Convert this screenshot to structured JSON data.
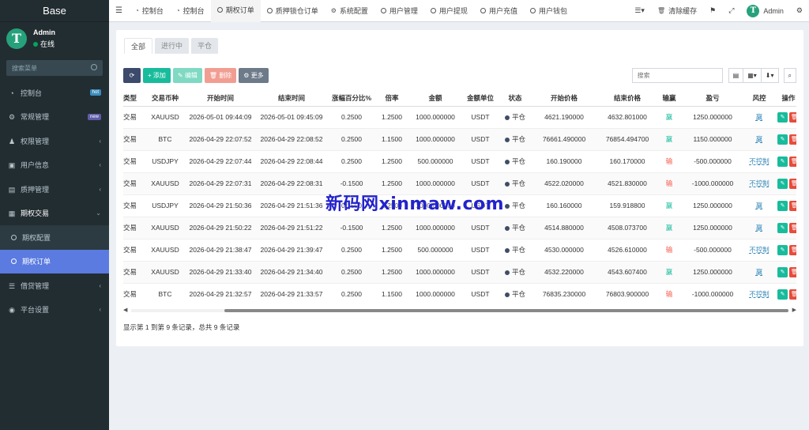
{
  "sidebar": {
    "brand": "Base",
    "user": {
      "name": "Admin",
      "status": "在线"
    },
    "search_placeholder": "搜索菜单",
    "items": [
      {
        "label": "控制台",
        "badge": "hot",
        "icon": "dashboard-icon"
      },
      {
        "label": "常规管理",
        "badge": "new",
        "icon": "cogs-icon"
      },
      {
        "label": "权限管理",
        "icon": "group-icon"
      },
      {
        "label": "用户信息",
        "icon": "user-card-icon"
      },
      {
        "label": "质押管理",
        "icon": "chart-icon"
      },
      {
        "label": "期权交易",
        "icon": "file-icon"
      }
    ],
    "sub_items": [
      {
        "label": "期权配置"
      },
      {
        "label": "期权订单"
      }
    ],
    "items_after": [
      {
        "label": "借贷管理",
        "icon": "list-icon"
      },
      {
        "label": "平台设置",
        "icon": "gear-icon"
      }
    ]
  },
  "topbar": {
    "tabs": [
      {
        "label": "控制台",
        "icon": "dashboard-icon"
      },
      {
        "label": "控制台",
        "icon": "dashboard-icon"
      },
      {
        "label": "期权订单",
        "icon": "circle-icon"
      },
      {
        "label": "质押锁仓订单",
        "icon": "circle-icon"
      },
      {
        "label": "系统配置",
        "icon": "gear-icon"
      },
      {
        "label": "用户管理",
        "icon": "circle-icon"
      },
      {
        "label": "用户提现",
        "icon": "circle-icon"
      },
      {
        "label": "用户充值",
        "icon": "circle-icon"
      },
      {
        "label": "用户钱包",
        "icon": "circle-icon"
      }
    ],
    "clear_cache": "清除缓存",
    "admin": "Admin"
  },
  "content": {
    "tabs": [
      "全部",
      "进行中",
      "平仓"
    ],
    "buttons": {
      "add": "添加",
      "edit": "编辑",
      "delete": "删除",
      "more": "更多"
    },
    "search_placeholder": "搜索",
    "columns": [
      "类型",
      "交易币种",
      "开始时间",
      "结束时间",
      "涨幅百分比%",
      "倍率",
      "金额",
      "金额单位",
      "状态",
      "开始价格",
      "结束价格",
      "输赢",
      "盈亏",
      "风控",
      "操作"
    ],
    "rows": [
      [
        "交易",
        "XAUUSD",
        "2026-05-01 09:44:09",
        "2026-05-01 09:45:09",
        "0.2500",
        "1.2500",
        "1000.000000",
        "USDT",
        "平仓",
        "4621.190000",
        "4632.801000",
        "赢",
        "1250.000000",
        "赢"
      ],
      [
        "交易",
        "BTC",
        "2026-04-29 22:07:52",
        "2026-04-29 22:08:52",
        "0.2500",
        "1.1500",
        "1000.000000",
        "USDT",
        "平仓",
        "76661.490000",
        "76854.494700",
        "赢",
        "1150.000000",
        "赢"
      ],
      [
        "交易",
        "USDJPY",
        "2026-04-29 22:07:44",
        "2026-04-29 22:08:44",
        "0.2500",
        "1.2500",
        "500.000000",
        "USDT",
        "平仓",
        "160.190000",
        "160.170000",
        "输",
        "-500.000000",
        "不控制"
      ],
      [
        "交易",
        "XAUUSD",
        "2026-04-29 22:07:31",
        "2026-04-29 22:08:31",
        "-0.1500",
        "1.2500",
        "1000.000000",
        "USDT",
        "平仓",
        "4522.020000",
        "4521.830000",
        "输",
        "-1000.000000",
        "不控制"
      ],
      [
        "交易",
        "USDJPY",
        "2026-04-29 21:50:36",
        "2026-04-29 21:51:36",
        "0.2500",
        "1.2500",
        "1000.000000",
        "USDT",
        "平仓",
        "160.160000",
        "159.918800",
        "赢",
        "1250.000000",
        "赢"
      ],
      [
        "交易",
        "XAUUSD",
        "2026-04-29 21:50:22",
        "2026-04-29 21:51:22",
        "-0.1500",
        "1.2500",
        "1000.000000",
        "USDT",
        "平仓",
        "4514.880000",
        "4508.073700",
        "赢",
        "1250.000000",
        "赢"
      ],
      [
        "交易",
        "XAUUSD",
        "2026-04-29 21:38:47",
        "2026-04-29 21:39:47",
        "0.2500",
        "1.2500",
        "500.000000",
        "USDT",
        "平仓",
        "4530.000000",
        "4526.610000",
        "输",
        "-500.000000",
        "不控制"
      ],
      [
        "交易",
        "XAUUSD",
        "2026-04-29 21:33:40",
        "2026-04-29 21:34:40",
        "0.2500",
        "1.2500",
        "1000.000000",
        "USDT",
        "平仓",
        "4532.220000",
        "4543.607400",
        "赢",
        "1250.000000",
        "赢"
      ],
      [
        "交易",
        "BTC",
        "2026-04-29 21:32:57",
        "2026-04-29 21:33:57",
        "0.2500",
        "1.1500",
        "1000.000000",
        "USDT",
        "平仓",
        "76835.230000",
        "76803.900000",
        "输",
        "-1000.000000",
        "不控制"
      ]
    ],
    "pager_text": "显示第 1 到第 9 条记录，总共 9 条记录"
  },
  "watermark": "新码网xinmaw.com"
}
